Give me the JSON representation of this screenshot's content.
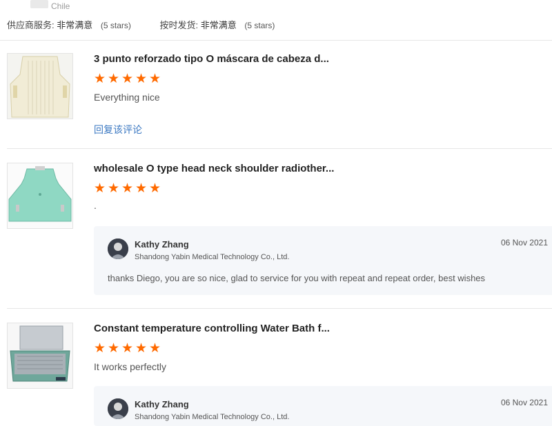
{
  "header": {
    "country": "Chile",
    "supplier_service_label": "供应商服务:",
    "supplier_service_value": "非常满意",
    "supplier_service_stars": "(5 stars)",
    "delivery_label": "按时发货:",
    "delivery_value": "非常满意",
    "delivery_stars": "(5 stars)"
  },
  "reviews": [
    {
      "title": "3 punto reforzado tipo O máscara de cabeza d...",
      "rating": 5,
      "comment": "Everything nice",
      "reply_link": "回复该评论"
    },
    {
      "title": "wholesale O type head neck shoulder radiother...",
      "rating": 5,
      "comment": ".",
      "reply": {
        "name": "Kathy Zhang",
        "company": "Shandong Yabin Medical Technology Co., Ltd.",
        "date": "06 Nov 2021",
        "text": "thanks Diego, you are so nice, glad to service for you with repeat and repeat order, best wishes"
      }
    },
    {
      "title": "Constant temperature controlling Water Bath f...",
      "rating": 5,
      "comment": "It works perfectly",
      "reply": {
        "name": "Kathy Zhang",
        "company": "Shandong Yabin Medical Technology Co., Ltd.",
        "date": "06 Nov 2021"
      }
    }
  ],
  "colors": {
    "star": "#ff6a00",
    "link": "#3b78c2",
    "reply_bg": "#f5f7fa"
  },
  "icons": {
    "star": "star-icon",
    "avatar": "avatar"
  }
}
